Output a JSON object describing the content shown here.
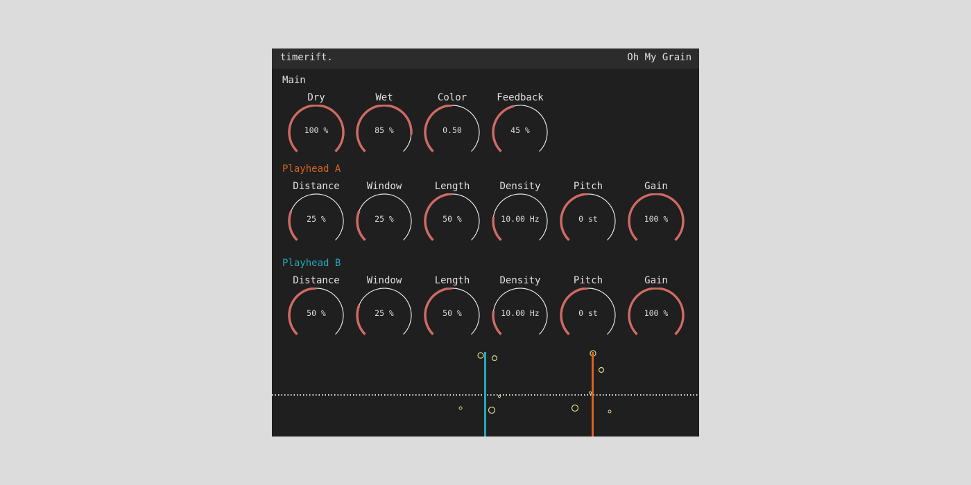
{
  "header": {
    "brand": "timerift.",
    "preset": "Oh My Grain"
  },
  "colors": {
    "panel_bg": "#1f1f1f",
    "titlebar_bg": "#2c2c2c",
    "knob_active": "#cf6a63",
    "knob_track": "#e6e6e6",
    "playhead_a": "#d8641f",
    "playhead_b": "#24a8bd",
    "grain": "#e0d690",
    "text": "#e0e0e0"
  },
  "main": {
    "label": "Main",
    "knobs": [
      {
        "name": "Dry",
        "value": "100 %",
        "fraction": 1.0
      },
      {
        "name": "Wet",
        "value": "85 %",
        "fraction": 0.85
      },
      {
        "name": "Color",
        "value": "0.50",
        "fraction": 0.5
      },
      {
        "name": "Feedback",
        "value": "45 %",
        "fraction": 0.45
      }
    ]
  },
  "playhead_a": {
    "label": "Playhead A",
    "knobs": [
      {
        "name": "Distance",
        "value": "25 %",
        "fraction": 0.25
      },
      {
        "name": "Window",
        "value": "25 %",
        "fraction": 0.25
      },
      {
        "name": "Length",
        "value": "50 %",
        "fraction": 0.5
      },
      {
        "name": "Density",
        "value": "10.00 Hz",
        "fraction": 0.2
      },
      {
        "name": "Pitch",
        "value": "0 st",
        "fraction": 0.5
      },
      {
        "name": "Gain",
        "value": "100 %",
        "fraction": 1.0
      }
    ]
  },
  "playhead_b": {
    "label": "Playhead B",
    "knobs": [
      {
        "name": "Distance",
        "value": "50 %",
        "fraction": 0.5
      },
      {
        "name": "Window",
        "value": "25 %",
        "fraction": 0.25
      },
      {
        "name": "Length",
        "value": "50 %",
        "fraction": 0.5
      },
      {
        "name": "Density",
        "value": "10.00 Hz",
        "fraction": 0.2
      },
      {
        "name": "Pitch",
        "value": "0 st",
        "fraction": 0.5
      },
      {
        "name": "Gain",
        "value": "100 %",
        "fraction": 1.0
      }
    ]
  }
}
